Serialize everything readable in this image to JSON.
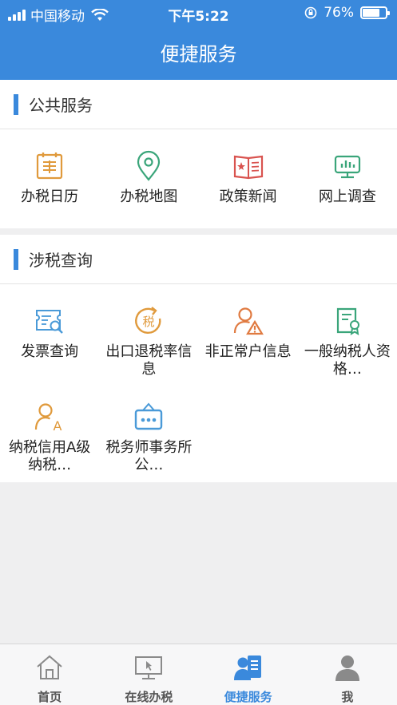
{
  "status_bar": {
    "carrier": "中国移动",
    "time": "下午5:22",
    "battery_percent": "76%",
    "battery_level": 0.76
  },
  "header": {
    "title": "便捷服务"
  },
  "sections": [
    {
      "title": "公共服务",
      "items": [
        {
          "label": "办税日历",
          "icon": "tax-calendar-icon"
        },
        {
          "label": "办税地图",
          "icon": "map-pin-icon"
        },
        {
          "label": "政策新闻",
          "icon": "news-book-icon"
        },
        {
          "label": "网上调查",
          "icon": "survey-screen-icon"
        }
      ]
    },
    {
      "title": "涉税查询",
      "items": [
        {
          "label": "发票查询",
          "icon": "invoice-search-icon"
        },
        {
          "label": "出口退税率信息",
          "icon": "tax-refund-icon"
        },
        {
          "label": "非正常户信息",
          "icon": "abnormal-account-icon"
        },
        {
          "label": "一般纳税人资格…",
          "icon": "taxpayer-certificate-icon"
        },
        {
          "label": "纳税信用A级纳税…",
          "icon": "credit-a-icon"
        },
        {
          "label": "税务师事务所公…",
          "icon": "tax-office-sign-icon"
        }
      ]
    }
  ],
  "tabbar": {
    "tabs": [
      {
        "label": "首页",
        "icon": "home-icon",
        "active": false
      },
      {
        "label": "在线办税",
        "icon": "monitor-icon",
        "active": false
      },
      {
        "label": "便捷服务",
        "icon": "service-person-icon",
        "active": true
      },
      {
        "label": "我",
        "icon": "user-icon",
        "active": false
      }
    ]
  },
  "colors": {
    "primary": "#3a89dc",
    "orange": "#e09a3c",
    "green": "#3aa57a",
    "red": "#d9534f",
    "blue_icon": "#4a9ad8"
  }
}
